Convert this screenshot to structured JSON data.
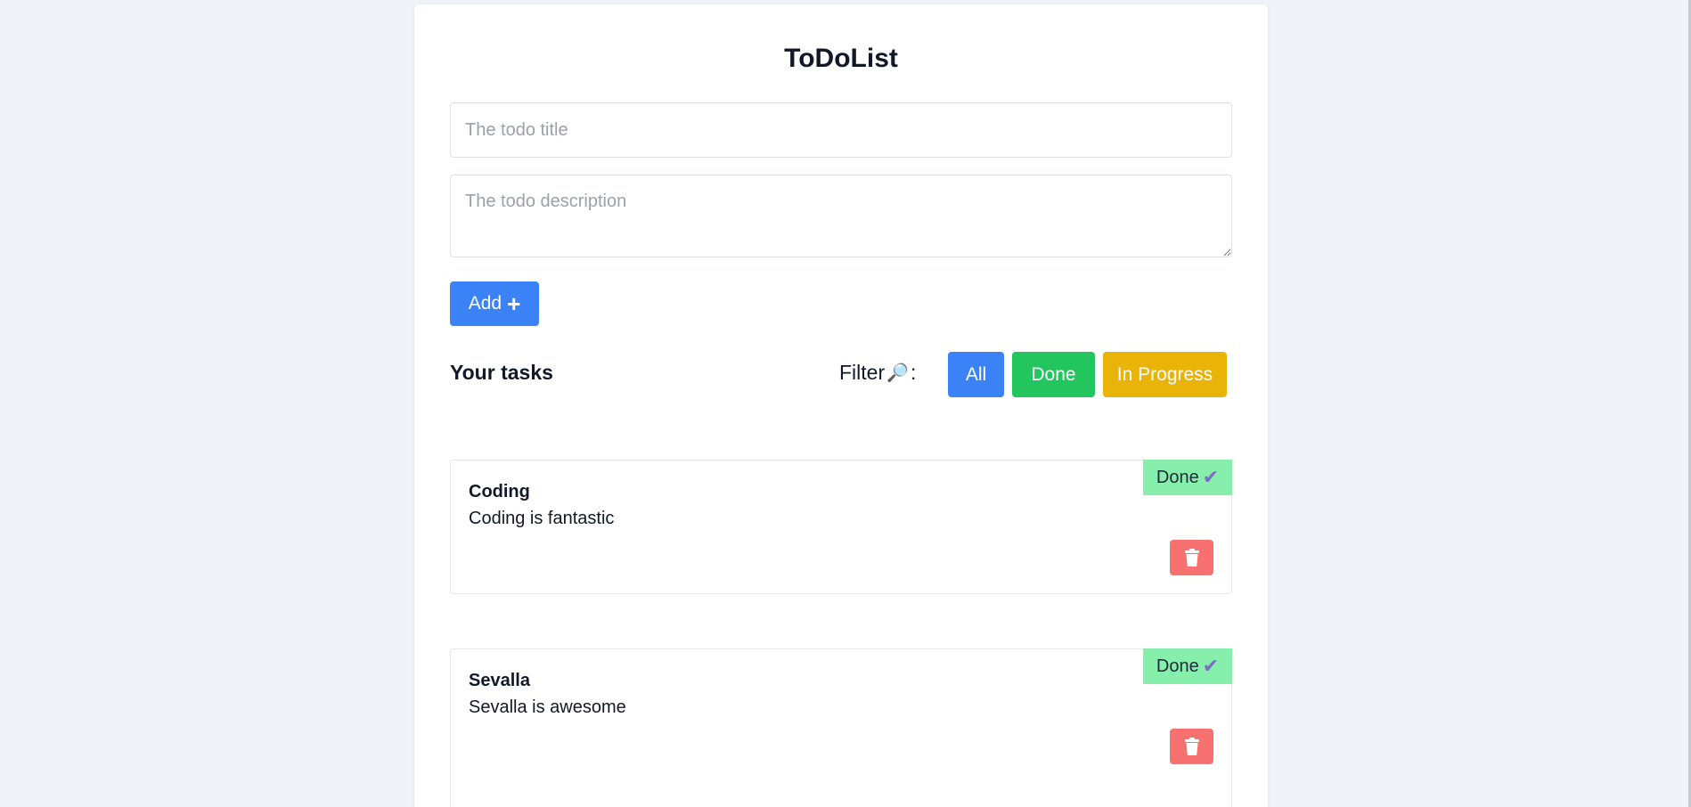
{
  "app": {
    "title": "ToDoList"
  },
  "form": {
    "title_placeholder": "The todo title",
    "description_placeholder": "The todo description",
    "add_label": "Add",
    "add_icon": "plus-icon"
  },
  "tasks_section": {
    "heading": "Your tasks",
    "filter_label": "Filter",
    "filter_icon": "🔎",
    "filter_colon": ":",
    "filters": [
      {
        "label": "All",
        "color": "#3b82f6"
      },
      {
        "label": "Done",
        "color": "#22c55e"
      },
      {
        "label": "In Progress",
        "color": "#eab308"
      }
    ]
  },
  "tasks": [
    {
      "title": "Coding",
      "description": "Coding is fantastic",
      "status": "Done",
      "status_color": "#86efac",
      "status_icon": "check-icon"
    },
    {
      "title": "Sevalla",
      "description": "Sevalla is awesome",
      "status": "Done",
      "status_color": "#86efac",
      "status_icon": "check-icon"
    }
  ],
  "colors": {
    "background": "#f0f4f9",
    "delete": "#f87171"
  }
}
